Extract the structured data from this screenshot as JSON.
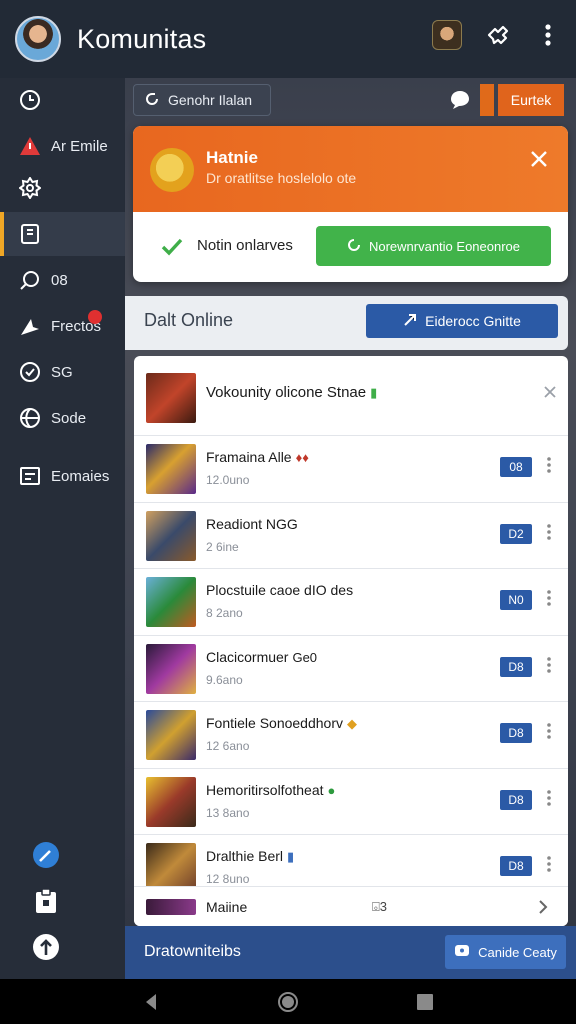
{
  "app": {
    "title": "Komunitas"
  },
  "topbar": {
    "icons": [
      "user-avatar",
      "share-icon",
      "more-vert-icon"
    ]
  },
  "sidebar": {
    "items": [
      {
        "label": "",
        "icon": "clock-icon"
      },
      {
        "label": "Ar Emile",
        "icon": "alert-icon"
      },
      {
        "label": "",
        "icon": "settings-icon"
      },
      {
        "label": "",
        "icon": "document-icon",
        "active": true
      },
      {
        "label": "08",
        "icon": "search-icon"
      },
      {
        "label": "Frectos",
        "icon": "send-icon",
        "badge": ""
      },
      {
        "label": "SG",
        "icon": "status-icon"
      },
      {
        "label": "Sode",
        "icon": "globe-icon"
      },
      {
        "label": "Eomaies",
        "icon": "list-icon"
      }
    ],
    "bottom_icons": [
      "edit-icon",
      "clipboard-icon",
      "upload-icon"
    ]
  },
  "toolbar": {
    "chip_label": "Genohr Ilalan",
    "cta_label": "Eurtek"
  },
  "notice": {
    "title": "Hatnie",
    "subtitle": "Dr oratlitse hoslelolo ote",
    "status": "Notin onlarves",
    "button_label": "Norewnrvantio Eoneonroe"
  },
  "online": {
    "label": "Dalt Online",
    "button_label": "Eiderocc Gnitte"
  },
  "list": {
    "header": "Vokounity olicone Stnae",
    "rows": [
      {
        "title": "Framaina Alle",
        "meta": "12.0uno",
        "badge": "08",
        "mark": "♦♦",
        "mark_color": "#c0392b"
      },
      {
        "title": "Readiont NGG",
        "meta": "2 6ine",
        "badge": "D2",
        "mark": "",
        "mark_color": ""
      },
      {
        "title": "Plocstuile caoe dIO des",
        "meta": "8 2ano",
        "badge": "N0",
        "mark": "",
        "mark_color": ""
      },
      {
        "title": "Clacicormuer",
        "meta": "9.6ano",
        "badge": "D8",
        "mark": "Ge0",
        "mark_color": "#1a1a1a"
      },
      {
        "title": "Fontiele Sonoeddhorv",
        "meta": "12 6ano",
        "badge": "D8",
        "mark": "◆",
        "mark_color": "#e0a020"
      },
      {
        "title": "Hemoritirsolfotheat",
        "meta": "13 8ano",
        "badge": "D8",
        "mark": "●",
        "mark_color": "#2e9a3e"
      },
      {
        "title": "Dralthie Berl",
        "meta": "12 8uno",
        "badge": "D8",
        "mark": "▮",
        "mark_color": "#3d6fbd"
      }
    ],
    "footer": {
      "label": "Maiine",
      "middle": "⌻3"
    }
  },
  "banner": {
    "text": "Dratowniteibs",
    "button_label": "Canide Ceaty"
  },
  "colors": {
    "accent_orange": "#e8671f",
    "accent_blue": "#2b5aa6",
    "accent_green": "#41b34a",
    "sidebar_bg": "#262d39"
  }
}
